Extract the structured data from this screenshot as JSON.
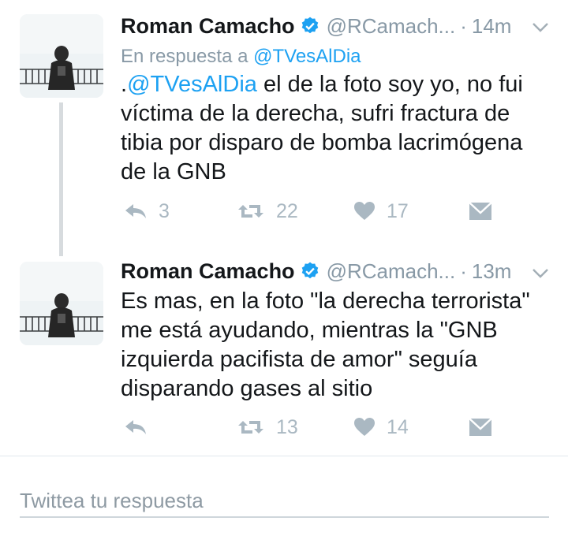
{
  "tweets": [
    {
      "name": "Roman Camacho",
      "handle": "@RCamach...",
      "separator": "·",
      "time": "14m",
      "reply_prefix": "En respuesta a",
      "reply_mention": "@TVesAlDia",
      "text_prefix": ".",
      "text_mention": "@TVesAlDia",
      "text_body": " el de la foto soy yo, no fui víctima de la derecha, sufri fractura de tibia por disparo de bomba lacrimógena de la GNB",
      "replies": "3",
      "retweets": "22",
      "likes": "17"
    },
    {
      "name": "Roman Camacho",
      "handle": "@RCamach...",
      "separator": "·",
      "time": "13m",
      "text_body": "Es mas, en la foto \"la derecha terrorista\" me está ayudando, mientras la \"GNB izquierda pacifista de amor\" seguía disparando gases al sitio",
      "retweets": "13",
      "likes": "14"
    }
  ],
  "compose": {
    "placeholder": "Twittea tu respuesta"
  },
  "colors": {
    "link": "#1da1f2",
    "muted": "#8899a6",
    "verified": "#1da1f2"
  },
  "icons": [
    "reply-icon",
    "retweet-icon",
    "like-icon",
    "dm-icon",
    "verified-icon",
    "caret-down-icon"
  ]
}
